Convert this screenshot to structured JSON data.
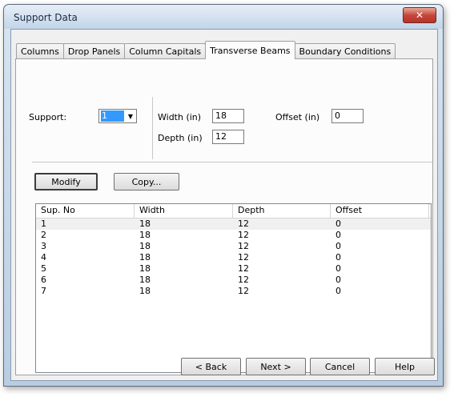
{
  "window": {
    "title": "Support Data",
    "close_label": "✕"
  },
  "tabs": [
    {
      "label": "Columns"
    },
    {
      "label": "Drop Panels"
    },
    {
      "label": "Column Capitals"
    },
    {
      "label": "Transverse Beams"
    },
    {
      "label": "Boundary Conditions"
    }
  ],
  "active_tab": "Transverse Beams",
  "form": {
    "support_label": "Support:",
    "support_value": "1",
    "width_label": "Width (in)",
    "width_value": "18",
    "depth_label": "Depth (in)",
    "depth_value": "12",
    "offset_label": "Offset (in)",
    "offset_value": "0"
  },
  "actions": {
    "modify_label": "Modify",
    "copy_label": "Copy..."
  },
  "table": {
    "columns": [
      "Sup. No",
      "Width",
      "Depth",
      "Offset"
    ],
    "rows": [
      [
        "1",
        "18",
        "12",
        "0"
      ],
      [
        "2",
        "18",
        "12",
        "0"
      ],
      [
        "3",
        "18",
        "12",
        "0"
      ],
      [
        "4",
        "18",
        "12",
        "0"
      ],
      [
        "5",
        "18",
        "12",
        "0"
      ],
      [
        "6",
        "18",
        "12",
        "0"
      ],
      [
        "7",
        "18",
        "12",
        "0"
      ]
    ]
  },
  "footer": {
    "back_label": "< Back",
    "next_label": "Next >",
    "cancel_label": "Cancel",
    "help_label": "Help"
  }
}
